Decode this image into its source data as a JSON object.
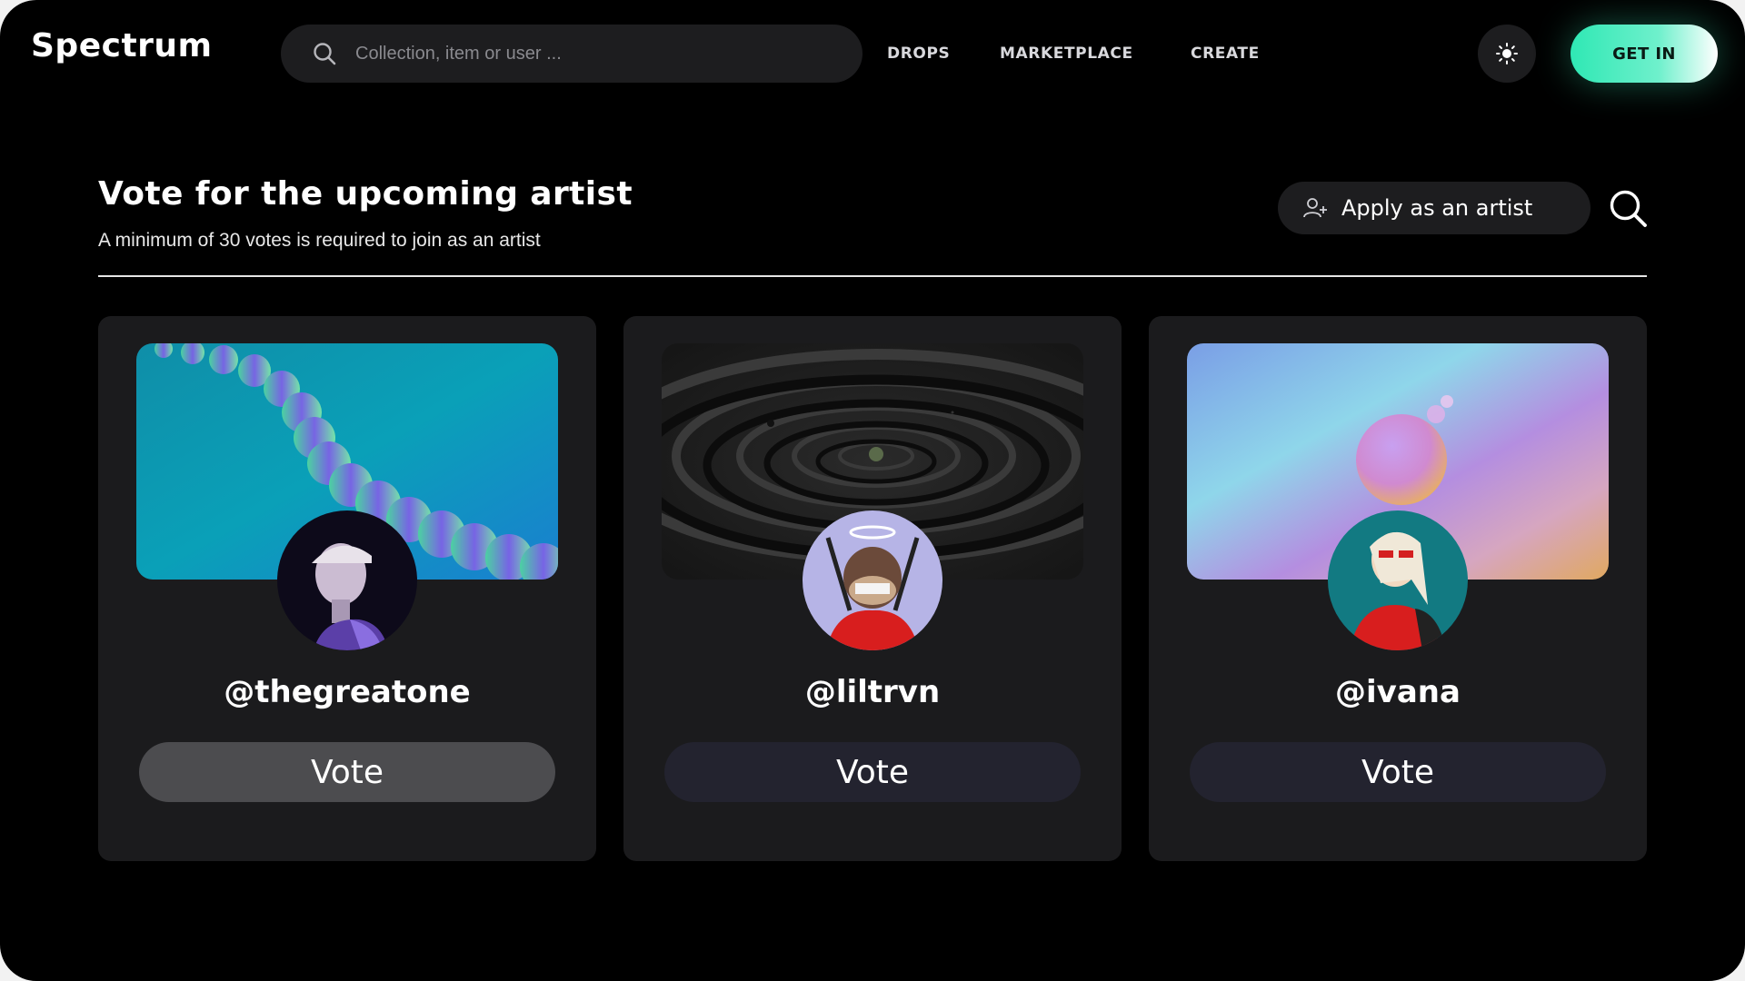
{
  "header": {
    "logo": "Spectrum",
    "search_placeholder": "Collection, item or user ...",
    "nav": [
      "DROPS",
      "MARKETPLACE",
      "CREATE"
    ],
    "theme_icon": "sun-icon",
    "cta_label": "GET IN"
  },
  "section": {
    "title": "Vote for the upcoming artist",
    "subtitle": "A minimum of 30 votes is required to join as an artist",
    "apply_label": "Apply as an artist",
    "apply_icon": "add-user-icon",
    "search_icon": "search-icon"
  },
  "cards": [
    {
      "handle": "@thegreatone",
      "vote_label": "Vote",
      "state": "selected"
    },
    {
      "handle": "@liltrvn",
      "vote_label": "Vote",
      "state": "default"
    },
    {
      "handle": "@ivana",
      "vote_label": "Vote",
      "state": "default"
    }
  ],
  "colors": {
    "background": "#000000",
    "card": "#1b1b1d",
    "accent": "#2fe8b4",
    "vote_selected": "#4c4c4f",
    "vote_default": "#23232f"
  }
}
